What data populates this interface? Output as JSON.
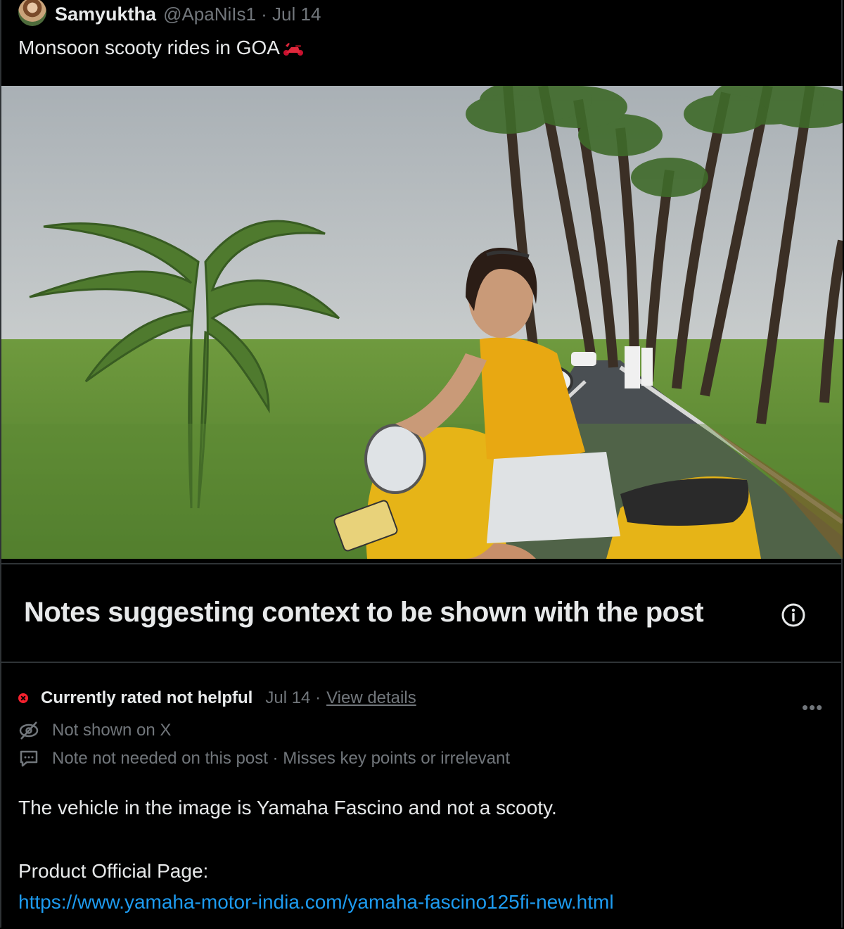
{
  "post": {
    "author_name": "Samyuktha",
    "handle_date": "@ApaNiIs1 · Jul 14",
    "text": "Monsoon scooty rides in GOA"
  },
  "notes": {
    "title": "Notes suggesting context to be shown with the post"
  },
  "note": {
    "status": "Currently rated not helpful",
    "date": "Jul 14 ·",
    "view_details": "View details",
    "not_shown": "Not shown on X",
    "reason": "Note not needed on this post · Misses key points or irrelevant",
    "body_line1": "The vehicle in the image is Yamaha Fascino and not a scooty.",
    "body_line2": "Product Official Page:",
    "link": "https://www.yamaha-motor-india.com/yamaha-fascino125fi-new.html"
  },
  "colors": {
    "background": "#000000",
    "text": "#e7e9ea",
    "muted": "#71767b",
    "link": "#1d9bf0",
    "not_helpful": "#f4212e",
    "scooter_yellow": "#e6b417"
  }
}
